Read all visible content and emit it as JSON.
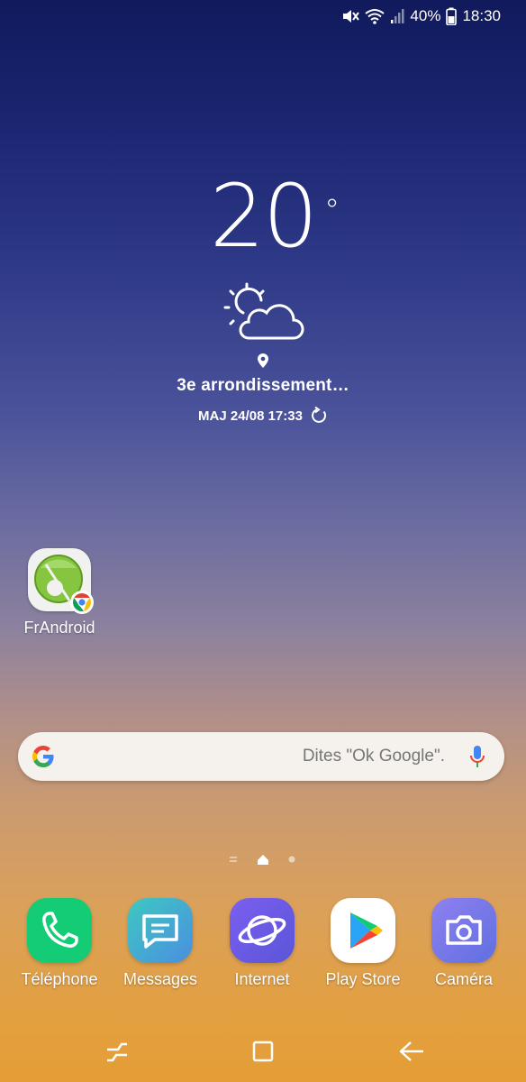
{
  "status_bar": {
    "battery_percent": "40%",
    "time": "18:30",
    "icons": [
      "mute-icon",
      "wifi-icon",
      "signal-icon",
      "battery-icon"
    ]
  },
  "weather": {
    "temperature": "20",
    "degree": "°",
    "condition_icon": "partly-cloudy-icon",
    "location": "3e arrondissement…",
    "updated": "MAJ 24/08 17:33"
  },
  "desktop_apps": [
    {
      "label": "FrAndroid",
      "icon": "frandroid-chrome-shortcut-icon"
    }
  ],
  "search": {
    "placeholder": "Dites \"Ok Google\"."
  },
  "dock": [
    {
      "label": "Téléphone",
      "icon": "phone-icon",
      "color": "#1ed37a"
    },
    {
      "label": "Messages",
      "icon": "messages-icon",
      "color": "#3fb3d8"
    },
    {
      "label": "Internet",
      "icon": "internet-icon",
      "color": "#6a5fe6"
    },
    {
      "label": "Play Store",
      "icon": "play-store-icon",
      "color": "#ffffff"
    },
    {
      "label": "Caméra",
      "icon": "camera-icon",
      "color": "#7b78e8"
    }
  ],
  "page_indicator": {
    "pages": 3,
    "current": 2
  },
  "nav": [
    "recents-button",
    "home-button",
    "back-button"
  ]
}
